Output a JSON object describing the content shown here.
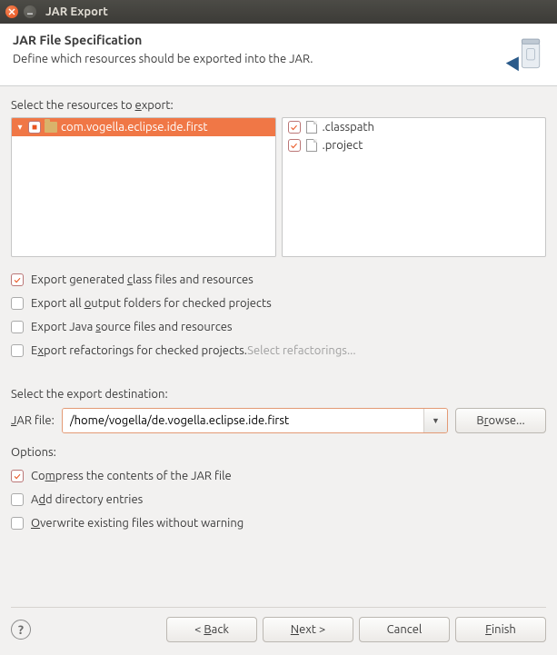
{
  "window": {
    "title": "JAR Export"
  },
  "header": {
    "title": "JAR File Specification",
    "subtitle": "Define which resources should be exported into the JAR."
  },
  "resources": {
    "label_pre": "Select the resources to ",
    "label_u": "e",
    "label_post": "xport:",
    "tree": [
      {
        "name": "com.vogella.eclipse.ide.first",
        "checked": true,
        "selected": true,
        "expanded": true
      }
    ],
    "files": [
      {
        "name": ".classpath",
        "checked": true
      },
      {
        "name": ".project",
        "checked": true
      }
    ]
  },
  "export_opts": {
    "gen_pre": "Export generated ",
    "gen_u": "c",
    "gen_post": "lass files and resources",
    "gen_checked": true,
    "out_pre": "Export all ",
    "out_u": "o",
    "out_post": "utput folders for checked projects",
    "out_checked": false,
    "src_pre": "Export Java ",
    "src_u": "s",
    "src_post": "ource files and resources",
    "src_checked": false,
    "ref_pre": "E",
    "ref_u": "x",
    "ref_post": "port refactorings for checked projects.",
    "ref_checked": false,
    "ref_link": "Select refactorings..."
  },
  "destination": {
    "label": "Select the export destination:",
    "field_u": "J",
    "field_post": "AR file:",
    "value": "/home/vogella/de.vogella.eclipse.ide.first",
    "browse_pre": "B",
    "browse_u": "r",
    "browse_post": "owse..."
  },
  "options": {
    "label": "Options:",
    "compress_pre": "Co",
    "compress_u": "m",
    "compress_post": "press the contents of the JAR file",
    "compress_checked": true,
    "dir_pre": "A",
    "dir_u": "d",
    "dir_post": "d directory entries",
    "dir_checked": false,
    "over_u": "O",
    "over_post": "verwrite existing files without warning",
    "over_checked": false
  },
  "footer": {
    "back_pre": "< ",
    "back_u": "B",
    "back_post": "ack",
    "next_u": "N",
    "next_post": "ext >",
    "cancel": "Cancel",
    "finish_u": "F",
    "finish_post": "inish"
  }
}
